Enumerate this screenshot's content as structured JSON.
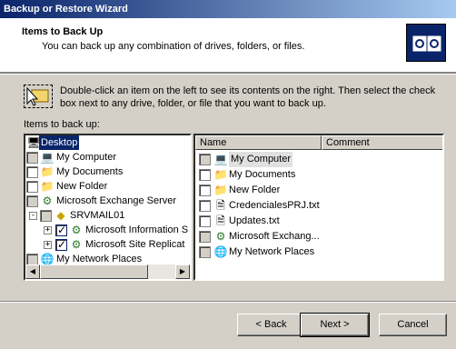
{
  "window": {
    "title": "Backup or Restore Wizard"
  },
  "header": {
    "title": "Items to Back Up",
    "subtitle": "You can back up any combination of drives, folders, or files.",
    "icon": "backup-wizard-icon"
  },
  "hint": "Double-click an item on the left to see its contents on the right. Then select the check box next to any drive, folder, or file that you want to back up.",
  "items_label": "Items to back up:",
  "tree": [
    {
      "label": "Desktop",
      "icon": "desktop-icon",
      "checkbox": "none",
      "selected": true
    },
    {
      "label": "My Computer",
      "icon": "computer-icon",
      "checkbox": "gray"
    },
    {
      "label": "My Documents",
      "icon": "documents-folder-icon",
      "checkbox": "empty"
    },
    {
      "label": "New Folder",
      "icon": "folder-icon",
      "checkbox": "empty"
    },
    {
      "label": "Microsoft Exchange Server",
      "icon": "exchange-icon",
      "checkbox": "gray"
    },
    {
      "label": "SRVMAIL01",
      "icon": "server-icon",
      "checkbox": "gray",
      "expander": "-"
    },
    {
      "label": "Microsoft Information S",
      "icon": "exchange-store-icon",
      "checkbox": "checked",
      "expander": "+"
    },
    {
      "label": "Microsoft Site Replicat",
      "icon": "exchange-store-icon",
      "checkbox": "checked",
      "expander": "+"
    },
    {
      "label": "My Network Places",
      "icon": "network-places-icon",
      "checkbox": "gray"
    }
  ],
  "list": {
    "columns": [
      "Name",
      "Comment"
    ],
    "rows": [
      {
        "name": "My Computer",
        "icon": "computer-icon",
        "checkbox": "gray",
        "highlight": true
      },
      {
        "name": "My Documents",
        "icon": "documents-folder-icon",
        "checkbox": "empty"
      },
      {
        "name": "New Folder",
        "icon": "folder-icon",
        "checkbox": "empty"
      },
      {
        "name": "CredencialesPRJ.txt",
        "icon": "text-file-icon",
        "checkbox": "empty"
      },
      {
        "name": "Updates.txt",
        "icon": "text-file-icon",
        "checkbox": "empty"
      },
      {
        "name": "Microsoft Exchang...",
        "icon": "exchange-icon",
        "checkbox": "gray"
      },
      {
        "name": "My Network Places",
        "icon": "network-places-icon",
        "checkbox": "gray"
      }
    ]
  },
  "buttons": {
    "back": "< Back",
    "next": "Next >",
    "cancel": "Cancel"
  }
}
